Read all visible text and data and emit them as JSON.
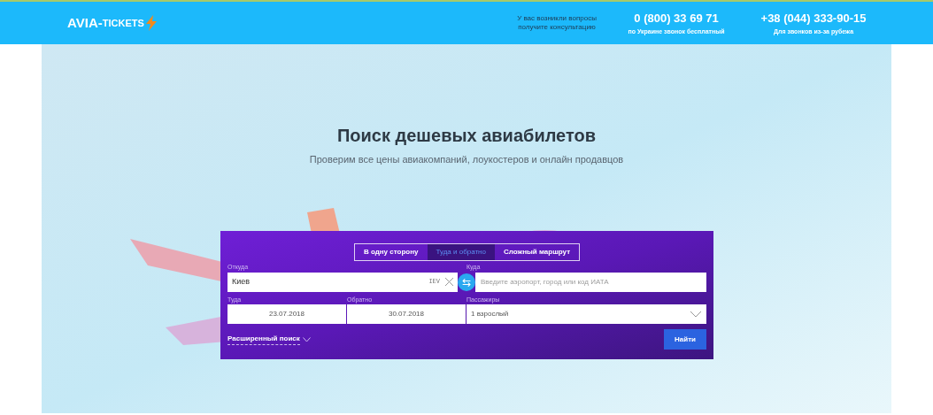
{
  "header": {
    "logo": {
      "part_1": "AVIA-",
      "part_2": "TICKETS"
    },
    "question": {
      "line_1": "У вас возникли вопросы",
      "line_2": "получите консультацию"
    },
    "phones": [
      {
        "number": "0 (800) 33 69 71",
        "note": "по Украине звонок бесплатный"
      },
      {
        "number": "+38 (044) 333-90-15",
        "note": "Для звонков из-за рубежа"
      }
    ]
  },
  "hero": {
    "title": "Поиск дешевых авиабилетов",
    "subtitle": "Проверим все цены авиакомпаний, лоукостеров и онлайн продавцов"
  },
  "search_form": {
    "tabs": [
      {
        "label": "В одну сторону",
        "selected": false
      },
      {
        "label": "Туда и обратно",
        "selected": true
      },
      {
        "label": "Сложный маршрут",
        "selected": false
      }
    ],
    "from": {
      "label": "Откуда",
      "value": "Киев",
      "code": "IEV"
    },
    "swap_symbol": "⇆",
    "to": {
      "label": "Куда",
      "placeholder": "Введите аэропорт, город или код ИАТА"
    },
    "depart": {
      "label": "Туда",
      "value": "23.07.2018"
    },
    "return": {
      "label": "Обратно",
      "value": "30.07.2018"
    },
    "passengers": {
      "label": "Пассажиры",
      "value": "1 взрослый"
    },
    "advanced_link": "Расширенный поиск",
    "submit": "Найти"
  }
}
